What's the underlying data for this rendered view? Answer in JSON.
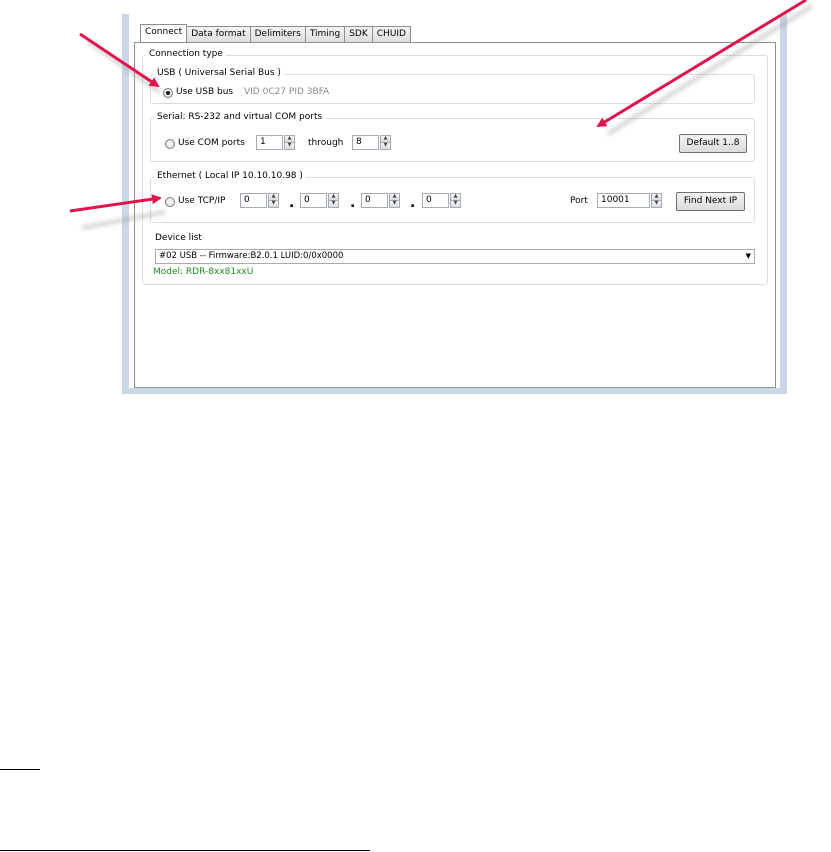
{
  "tabs": [
    "Connect",
    "Data format",
    "Delimiters",
    "Timing",
    "SDK",
    "CHUID"
  ],
  "active_tab": "Connect",
  "connection_type": {
    "title": "Connection type",
    "usb": {
      "group_title": "USB ( Universal Serial Bus )",
      "radio_label": "Use USB bus",
      "ids": "VID 0C27  PID 3BFA",
      "selected": true
    },
    "serial": {
      "group_title": "Serial: RS-232 and virtual COM ports",
      "radio_label": "Use COM ports",
      "from": "1",
      "through_label": "through",
      "to": "8",
      "default_button": "Default 1..8"
    },
    "ethernet": {
      "group_title": "Ethernet ( Local IP 10.10.10.98 )",
      "radio_label": "Use TCP/IP",
      "ip": [
        "0",
        "0",
        "0",
        "0"
      ],
      "port_label": "Port",
      "port": "10001",
      "find_button": "Find Next IP"
    }
  },
  "device_list": {
    "label": "Device list",
    "selected": "#02 USB -- Firmware:B2.0.1 LUID:0/0x0000",
    "model": "Model: RDR-8xx81xxU"
  },
  "colors": {
    "arrow": "#e0144c",
    "frame": "#c9d7e6",
    "model_text": "#1f8f1f"
  }
}
